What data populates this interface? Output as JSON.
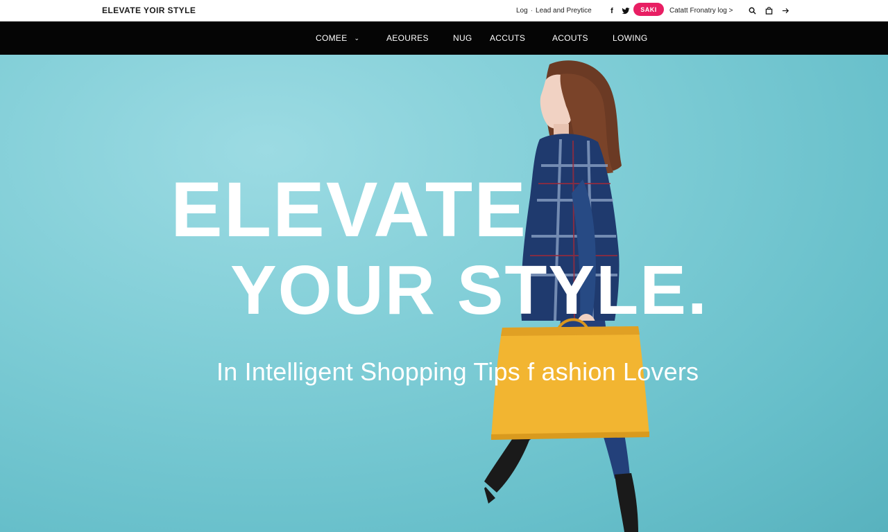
{
  "header": {
    "brand": "ELEVATE YOIR STYLE",
    "util_links": [
      "Log",
      "Lead and Preytice"
    ],
    "social": [
      {
        "name": "facebook",
        "glyph": "f"
      },
      {
        "name": "twitter",
        "glyph": "t"
      }
    ],
    "cta_label": "SAKI",
    "cta_color": "#e81e63",
    "account_label": "Catatt Fronatry log >",
    "tools": [
      {
        "name": "search-icon",
        "glyph": "⌕"
      },
      {
        "name": "bag-icon",
        "glyph": "⊡"
      },
      {
        "name": "arrow-icon",
        "glyph": "→"
      }
    ]
  },
  "nav": {
    "items": [
      {
        "label": "COMEE",
        "has_dropdown": true
      },
      {
        "label": "AEOURES",
        "has_dropdown": false
      },
      {
        "label": "NUG",
        "has_dropdown": false
      },
      {
        "label": "ACCUTS",
        "has_dropdown": false
      },
      {
        "label": "ACOUTS",
        "has_dropdown": false
      },
      {
        "label": "LOWING",
        "has_dropdown": false
      }
    ],
    "chevron": "⌄"
  },
  "hero": {
    "line1": "ELEVATE",
    "line2": "YOUR STYLE.",
    "subtitle": "In Intelligent Shopping Tips f ashion Lovers",
    "bg_color": "#7fcdd6",
    "bag_color": "#f2b531"
  }
}
